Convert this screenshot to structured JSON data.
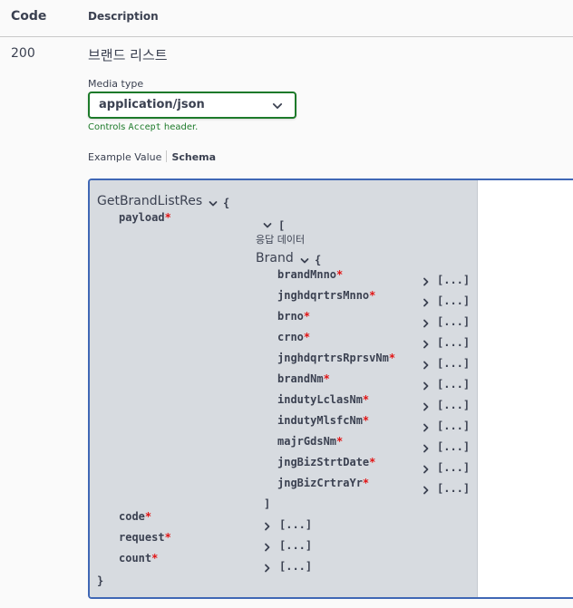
{
  "header": {
    "code": "Code",
    "description": "Description"
  },
  "response": {
    "code": "200",
    "description": "브랜드 리스트",
    "media_type_label": "Media type",
    "media_type_value": "application/json",
    "controls_prefix": "Controls",
    "controls_code": "Accept",
    "controls_suffix": "header."
  },
  "tabs": {
    "example": "Example Value",
    "schema": "Schema"
  },
  "schema": {
    "root_model": "GetBrandListRes",
    "open_brace": "{",
    "close_brace": "}",
    "payload": {
      "name": "payload",
      "array_open": "[",
      "array_close": "]",
      "description": "응답 데이터"
    },
    "item_model": "Brand",
    "brand_fields": [
      "brandMnno",
      "jnghdqrtrsMnno",
      "brno",
      "crno",
      "jnghdqrtrsRprsvNm",
      "brandNm",
      "indutyLclasNm",
      "indutyMlsfcNm",
      "majrGdsNm",
      "jngBizStrtDate",
      "jngBizCrtraYr"
    ],
    "other_fields": [
      "code",
      "request",
      "count"
    ],
    "collapsed_text": "[...]",
    "required_mark": "*"
  },
  "colors": {
    "accent_green": "#1d7a2a",
    "border_blue": "#3f67b5",
    "required_red": "#e21515"
  }
}
